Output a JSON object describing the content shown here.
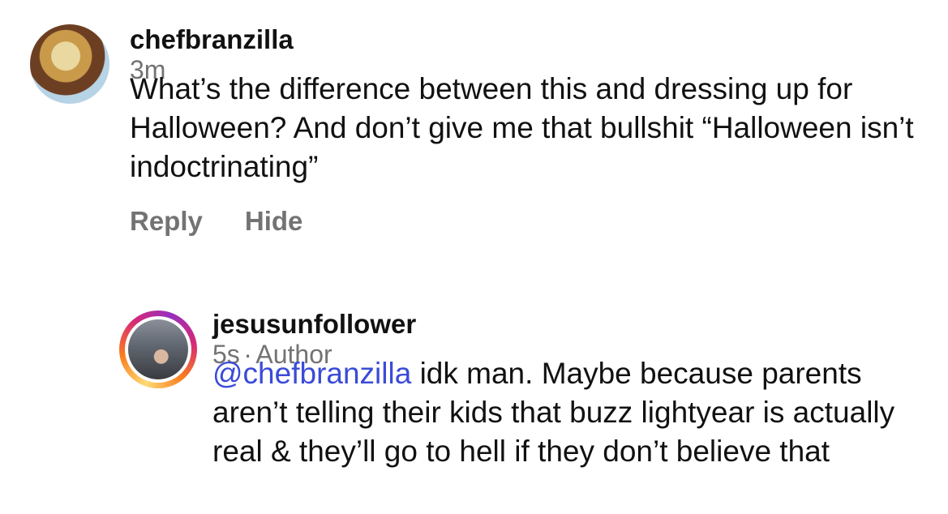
{
  "comments": [
    {
      "username": "chefbranzilla",
      "time": "3m",
      "text": "What’s the difference between this and dressing up for Halloween? And don’t give me that bullshit “Halloween isn’t indoctrinating”",
      "actions": {
        "reply": "Reply",
        "hide": "Hide"
      }
    }
  ],
  "reply": {
    "username": "jesusunfollower",
    "time": "5s",
    "separator": "·",
    "role": "Author",
    "mention": "@chefbranzilla",
    "text": " idk man. Maybe because parents aren’t telling their kids that buzz lightyear is actually real & they’ll go to hell if they don’t believe that"
  },
  "colors": {
    "mention": "#3b4bd8",
    "meta": "#737373",
    "text": "#111111"
  }
}
